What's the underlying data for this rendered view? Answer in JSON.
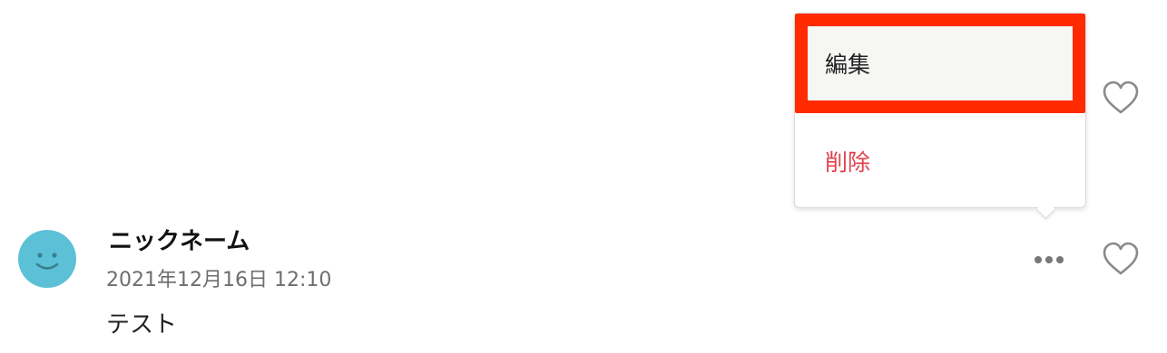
{
  "context_menu": {
    "edit_label": "編集",
    "delete_label": "削除"
  },
  "comment": {
    "nickname": "ニックネーム",
    "timestamp": "2021年12月16日 12:10",
    "text": "テスト"
  },
  "icons": {
    "like": "heart-outline-icon",
    "more": "more-horizontal-icon",
    "avatar": "smiley-face-icon"
  },
  "colors": {
    "highlight": "#ff2a00",
    "delete": "#e0414e",
    "avatar": "#5cc1d6"
  }
}
